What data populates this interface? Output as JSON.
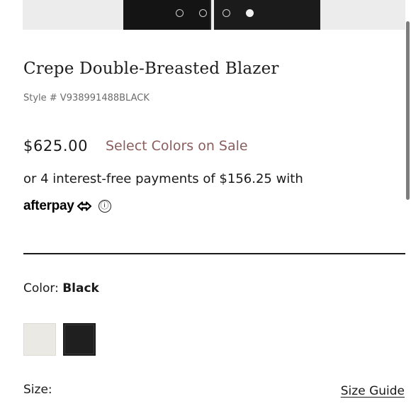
{
  "gallery": {
    "slide_count": 4,
    "active_slide": 4
  },
  "product": {
    "title": "Crepe Double-Breasted Blazer",
    "style_number": "Style # V938991488BLACK",
    "price": "$625.00",
    "sale_link": "Select Colors on Sale",
    "installments": "or 4 interest-free payments of $156.25 with",
    "afterpay_logo": "afterpay",
    "info_icon": "ⓘ"
  },
  "color": {
    "label": "Color:",
    "selected": "Black",
    "swatches": [
      {
        "name": "ivory",
        "hex": "#ebe9e4"
      },
      {
        "name": "black",
        "hex": "#1f1f1f"
      }
    ]
  },
  "size": {
    "label": "Size:",
    "guide_link": "Size Guide"
  },
  "colors": {
    "sale_text": "#8a5d5d",
    "text": "#1a1a1a",
    "muted": "#6b6b6b"
  }
}
